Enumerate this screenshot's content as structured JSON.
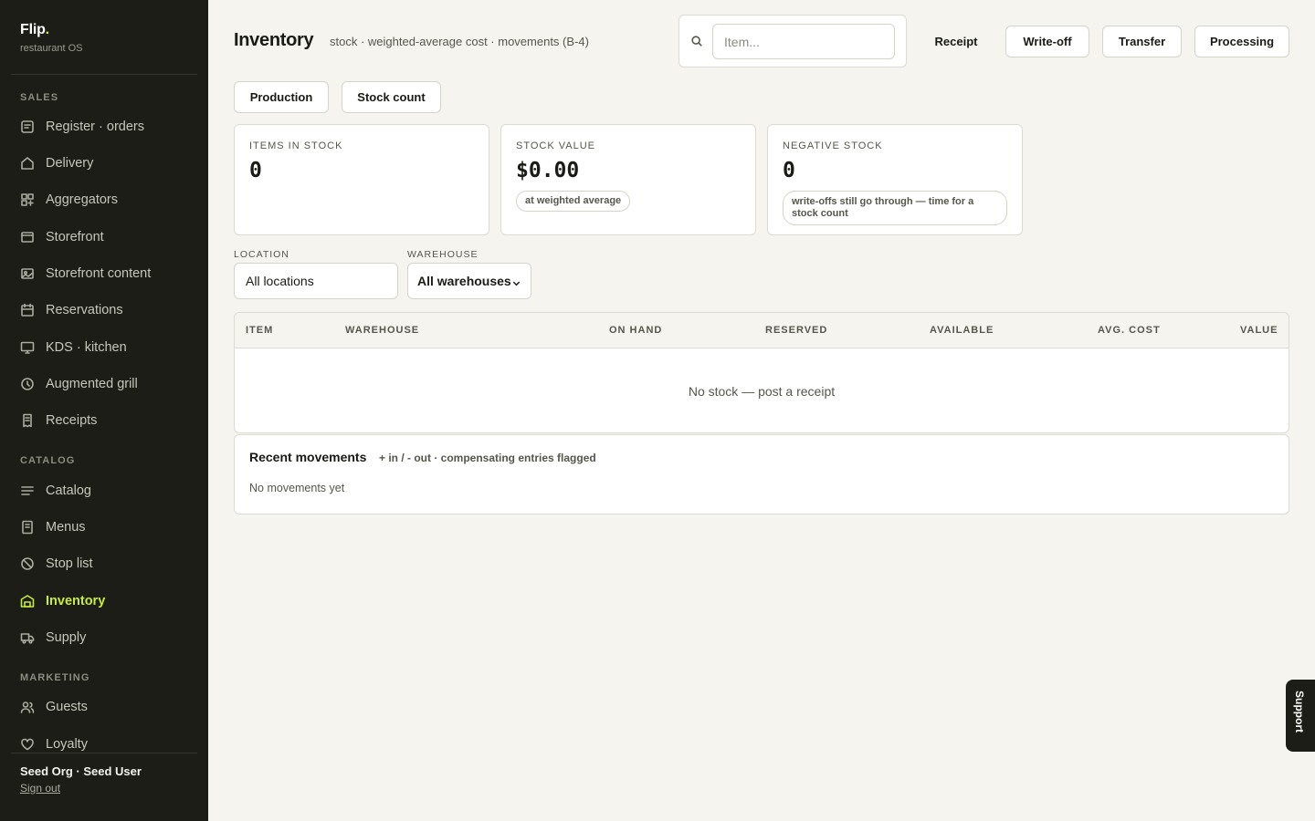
{
  "brand": {
    "name": "Flip",
    "dot": ".",
    "subtitle": "restaurant OS"
  },
  "sidebar": {
    "sections": [
      {
        "title": "SALES"
      },
      {
        "title": "CATALOG"
      },
      {
        "title": "MARKETING"
      }
    ],
    "items": [
      {
        "label": "Register · orders",
        "icon": "receipt-list-icon"
      },
      {
        "label": "Delivery",
        "icon": "home-icon"
      },
      {
        "label": "Aggregators",
        "icon": "grid-icon"
      },
      {
        "label": "Storefront",
        "icon": "browser-icon"
      },
      {
        "label": "Storefront content",
        "icon": "image-icon"
      },
      {
        "label": "Reservations",
        "icon": "calendar-icon"
      },
      {
        "label": "KDS · kitchen",
        "icon": "monitor-icon"
      },
      {
        "label": "Augmented grill",
        "icon": "clock-icon"
      },
      {
        "label": "Receipts",
        "icon": "receipt-icon"
      },
      {
        "label": "Catalog",
        "icon": "list-icon"
      },
      {
        "label": "Menus",
        "icon": "menu-book-icon"
      },
      {
        "label": "Stop list",
        "icon": "ban-icon"
      },
      {
        "label": "Inventory",
        "icon": "warehouse-icon",
        "active": true
      },
      {
        "label": "Supply",
        "icon": "truck-icon"
      },
      {
        "label": "Guests",
        "icon": "users-icon"
      },
      {
        "label": "Loyalty",
        "icon": "heart-icon"
      }
    ],
    "footer": {
      "user": "Seed Org · Seed User",
      "signout": "Sign out"
    }
  },
  "header": {
    "title": "Inventory",
    "subtitle": "stock · weighted-average cost · movements (B-4)",
    "search_placeholder": "Item...",
    "actions": {
      "receipt": "Receipt",
      "write_off": "Write-off",
      "transfer": "Transfer",
      "processing": "Processing",
      "production": "Production",
      "stock_count": "Stock count"
    }
  },
  "stats": [
    {
      "label": "ITEMS IN STOCK",
      "value": "0",
      "note": ""
    },
    {
      "label": "STOCK VALUE",
      "value": "$0.00",
      "note": "at weighted average"
    },
    {
      "label": "NEGATIVE STOCK",
      "value": "0",
      "note": "write-offs still go through — time for a stock count"
    }
  ],
  "filters": {
    "location": {
      "label": "LOCATION",
      "value": "All locations"
    },
    "warehouse": {
      "label": "WAREHOUSE",
      "value": "All warehouses"
    }
  },
  "table": {
    "columns": [
      "ITEM",
      "WAREHOUSE",
      "ON HAND",
      "RESERVED",
      "AVAILABLE",
      "AVG. COST",
      "VALUE"
    ],
    "rows": [],
    "empty": "No stock — post a receipt"
  },
  "movements": {
    "title": "Recent movements",
    "subtitle": "+ in / - out · compensating entries flagged",
    "empty": "No movements yet"
  },
  "support": {
    "label": "Support"
  },
  "colors": {
    "accent": "#c8ec3a",
    "sidebar_bg": "#1b1d16",
    "page_bg": "#f5f4ef"
  }
}
